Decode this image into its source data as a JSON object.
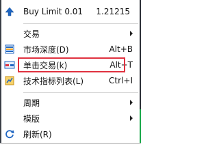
{
  "menu": {
    "buy_limit": {
      "label": "Buy Limit 0.01",
      "price": "1.21215",
      "icon": "arrow-up-icon"
    },
    "items": [
      {
        "label": "交易",
        "shortcut": "",
        "submenu": true,
        "icon": ""
      },
      {
        "label": "市场深度(D)",
        "shortcut": "Alt+B",
        "submenu": false,
        "icon": "market-depth-icon"
      },
      {
        "label": "单击交易(k)",
        "shortcut": "Alt+T",
        "submenu": false,
        "icon": "one-click-trading-icon"
      },
      {
        "label": "技术指标列表(L)",
        "shortcut": "Ctrl+I",
        "submenu": false,
        "icon": "indicators-list-icon"
      },
      {
        "label": "周期",
        "shortcut": "",
        "submenu": true,
        "icon": ""
      },
      {
        "label": "模版",
        "shortcut": "",
        "submenu": true,
        "icon": ""
      },
      {
        "label": "刷新(R)",
        "shortcut": "",
        "submenu": false,
        "icon": "refresh-icon"
      }
    ]
  },
  "colors": {
    "highlight_border": "#e0313f",
    "icon_blue": "#1f66c2",
    "icon_orange": "#f2a62b",
    "frame_dark": "#2b2f36",
    "frame_green": "#1aa84a"
  }
}
